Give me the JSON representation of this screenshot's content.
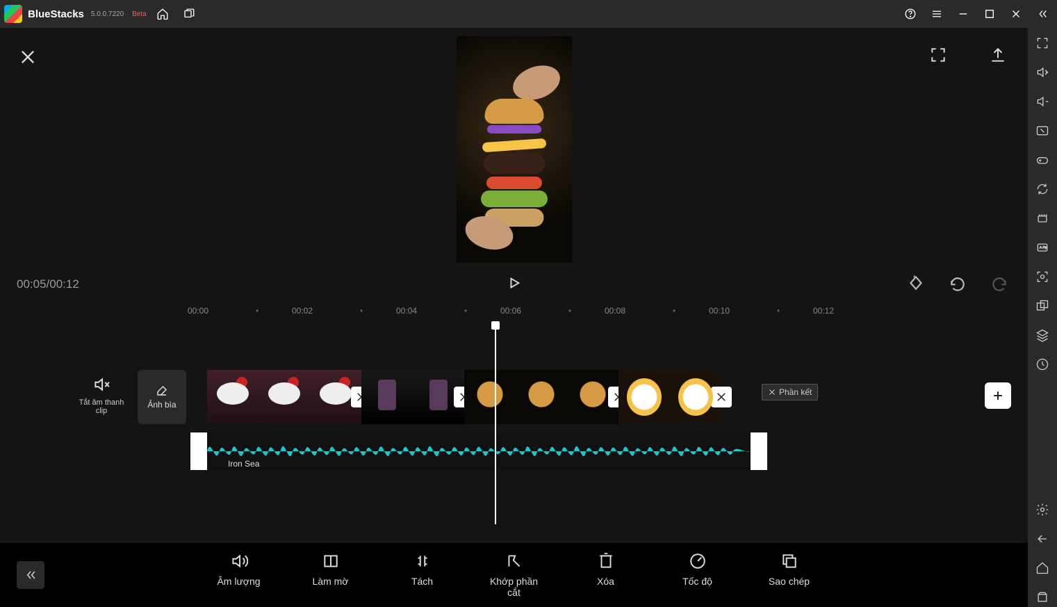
{
  "titlebar": {
    "brand": "BlueStacks",
    "version": "5.0.0.7220",
    "beta": "Beta"
  },
  "preview": {
    "timecode": "00:05/00:12"
  },
  "ruler": [
    "00:00",
    "00:02",
    "00:04",
    "00:06",
    "00:08",
    "00:10",
    "00:12"
  ],
  "timeline": {
    "mute_label": "Tắt âm thanh clip",
    "cover_label": "Ảnh bìa",
    "end_label": "Phần kết",
    "audio_name": "Iron Sea"
  },
  "tools": [
    {
      "id": "volume",
      "label": "Âm lượng"
    },
    {
      "id": "fade",
      "label": "Làm mờ"
    },
    {
      "id": "split",
      "label": "Tách"
    },
    {
      "id": "trim",
      "label": "Khớp phần cắt"
    },
    {
      "id": "delete",
      "label": "Xóa"
    },
    {
      "id": "speed",
      "label": "Tốc độ"
    },
    {
      "id": "copy",
      "label": "Sao chép"
    }
  ]
}
